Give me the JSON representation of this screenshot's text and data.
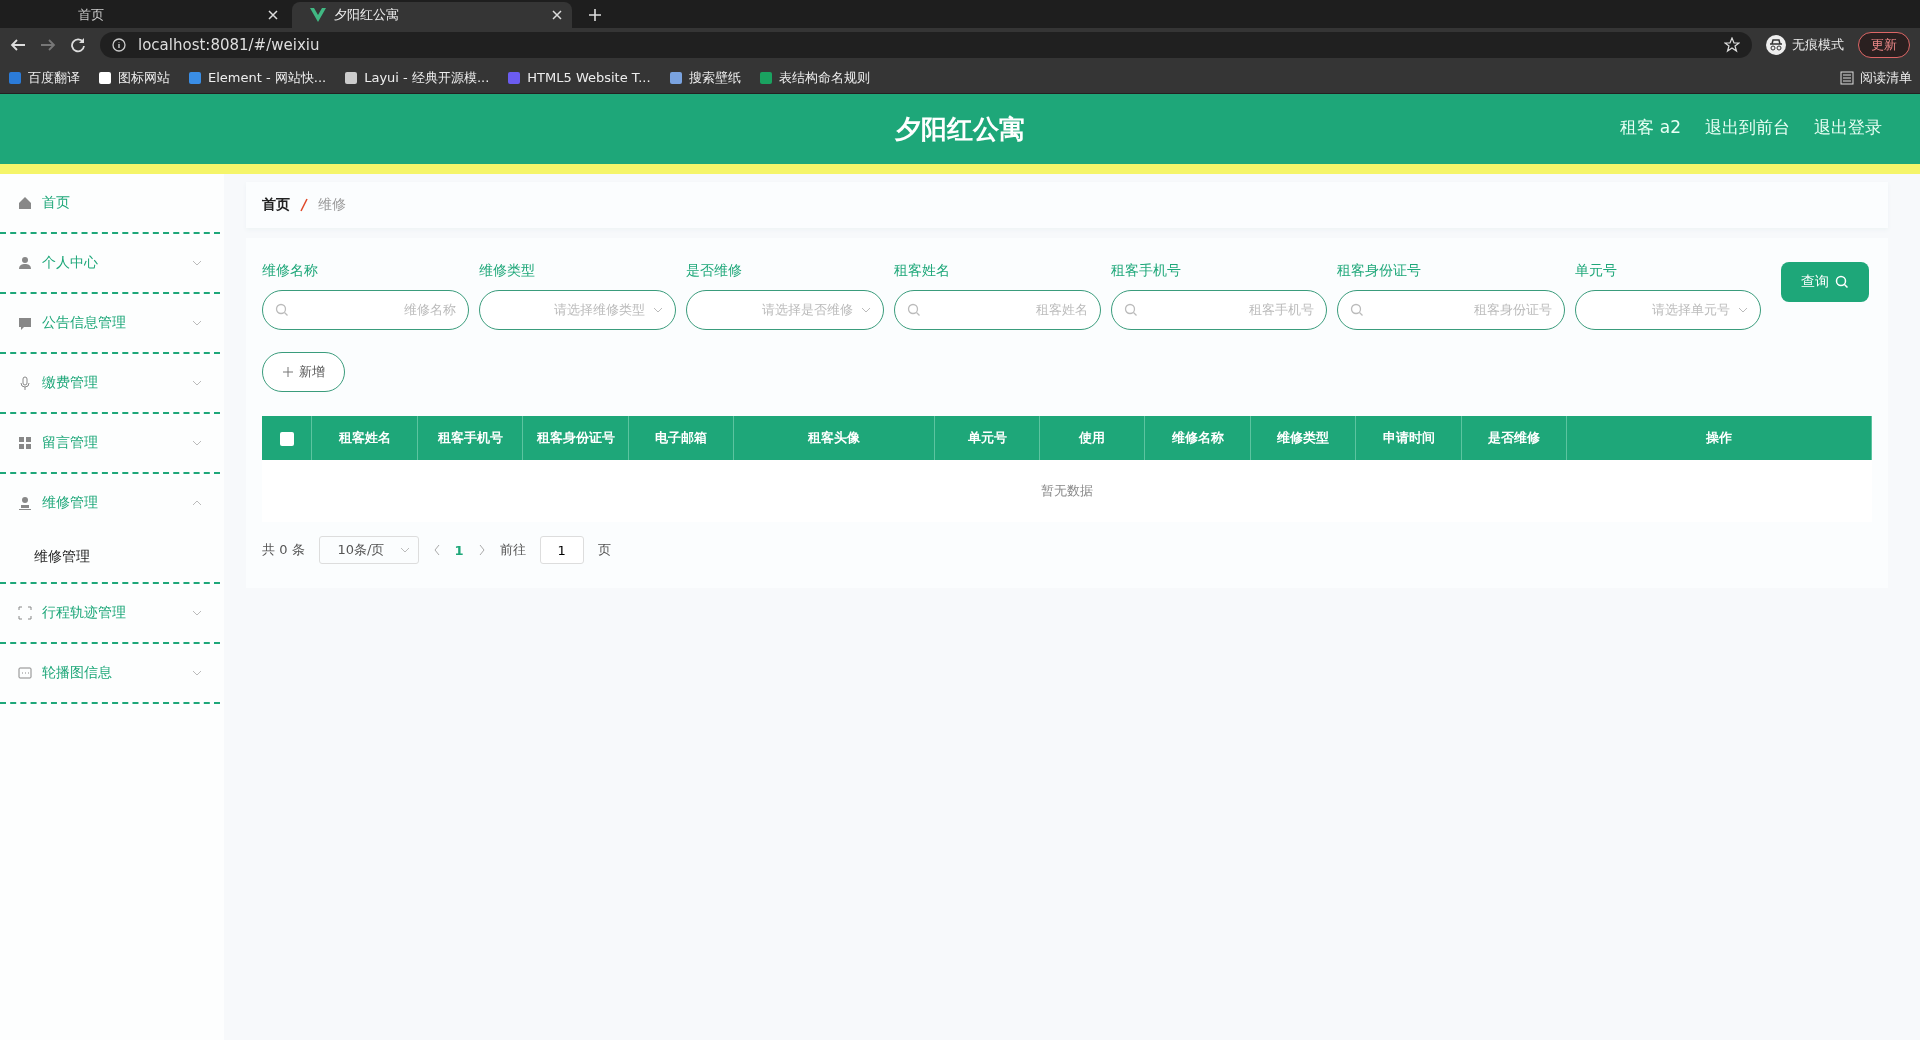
{
  "browser": {
    "tabs": [
      {
        "title": "首页",
        "selected": false
      },
      {
        "title": "夕阳红公寓",
        "selected": true
      }
    ],
    "url": "localhost:8081/#/weixiu",
    "incognito": "无痕模式",
    "update": "更新",
    "bookmarks": [
      "百度翻译",
      "图标网站",
      "Element - 网站快...",
      "Layui - 经典开源模...",
      "HTML5 Website T...",
      "搜索壁纸",
      "表结构命名规则"
    ],
    "reading_list": "阅读清单"
  },
  "header": {
    "title": "夕阳红公寓",
    "links": [
      "租客 a2",
      "退出到前台",
      "退出登录"
    ]
  },
  "sidebar": {
    "items": [
      {
        "label": "首页"
      },
      {
        "label": "个人中心",
        "expanded": false
      },
      {
        "label": "公告信息管理",
        "expanded": false
      },
      {
        "label": "缴费管理",
        "expanded": false
      },
      {
        "label": "留言管理",
        "expanded": false
      },
      {
        "label": "维修管理",
        "expanded": true,
        "children": [
          {
            "label": "维修管理"
          }
        ]
      },
      {
        "label": "行程轨迹管理",
        "expanded": false
      },
      {
        "label": "轮播图信息",
        "expanded": false
      }
    ]
  },
  "breadcrumb": [
    "首页",
    "维修"
  ],
  "filters": [
    {
      "kind": "text",
      "label": "维修名称",
      "placeholder": "维修名称"
    },
    {
      "kind": "select",
      "label": "维修类型",
      "placeholder": "请选择维修类型"
    },
    {
      "kind": "select",
      "label": "是否维修",
      "placeholder": "请选择是否维修"
    },
    {
      "kind": "text",
      "label": "租客姓名",
      "placeholder": "租客姓名"
    },
    {
      "kind": "text",
      "label": "租客手机号",
      "placeholder": "租客手机号"
    },
    {
      "kind": "text",
      "label": "租客身份证号",
      "placeholder": "租客身份证号"
    },
    {
      "kind": "select",
      "label": "单元号",
      "placeholder": "请选择单元号"
    }
  ],
  "query_button": "查询",
  "add_button": "新增",
  "table": {
    "select_all": {
      "checked": false
    },
    "columns": [
      "租客姓名",
      "租客手机号",
      "租客身份证号",
      "电子邮箱",
      "租客头像",
      "单元号",
      "使用",
      "维修名称",
      "维修类型",
      "申请时间",
      "是否维修",
      "操作"
    ],
    "empty_text": "暂无数据"
  },
  "pagination": {
    "total": "共 0 条",
    "page_size": "10条/页",
    "pages": [
      {
        "label": "1",
        "selected": true
      }
    ],
    "goto_label": "前往",
    "goto_value": "1",
    "goto_suffix": "页"
  }
}
